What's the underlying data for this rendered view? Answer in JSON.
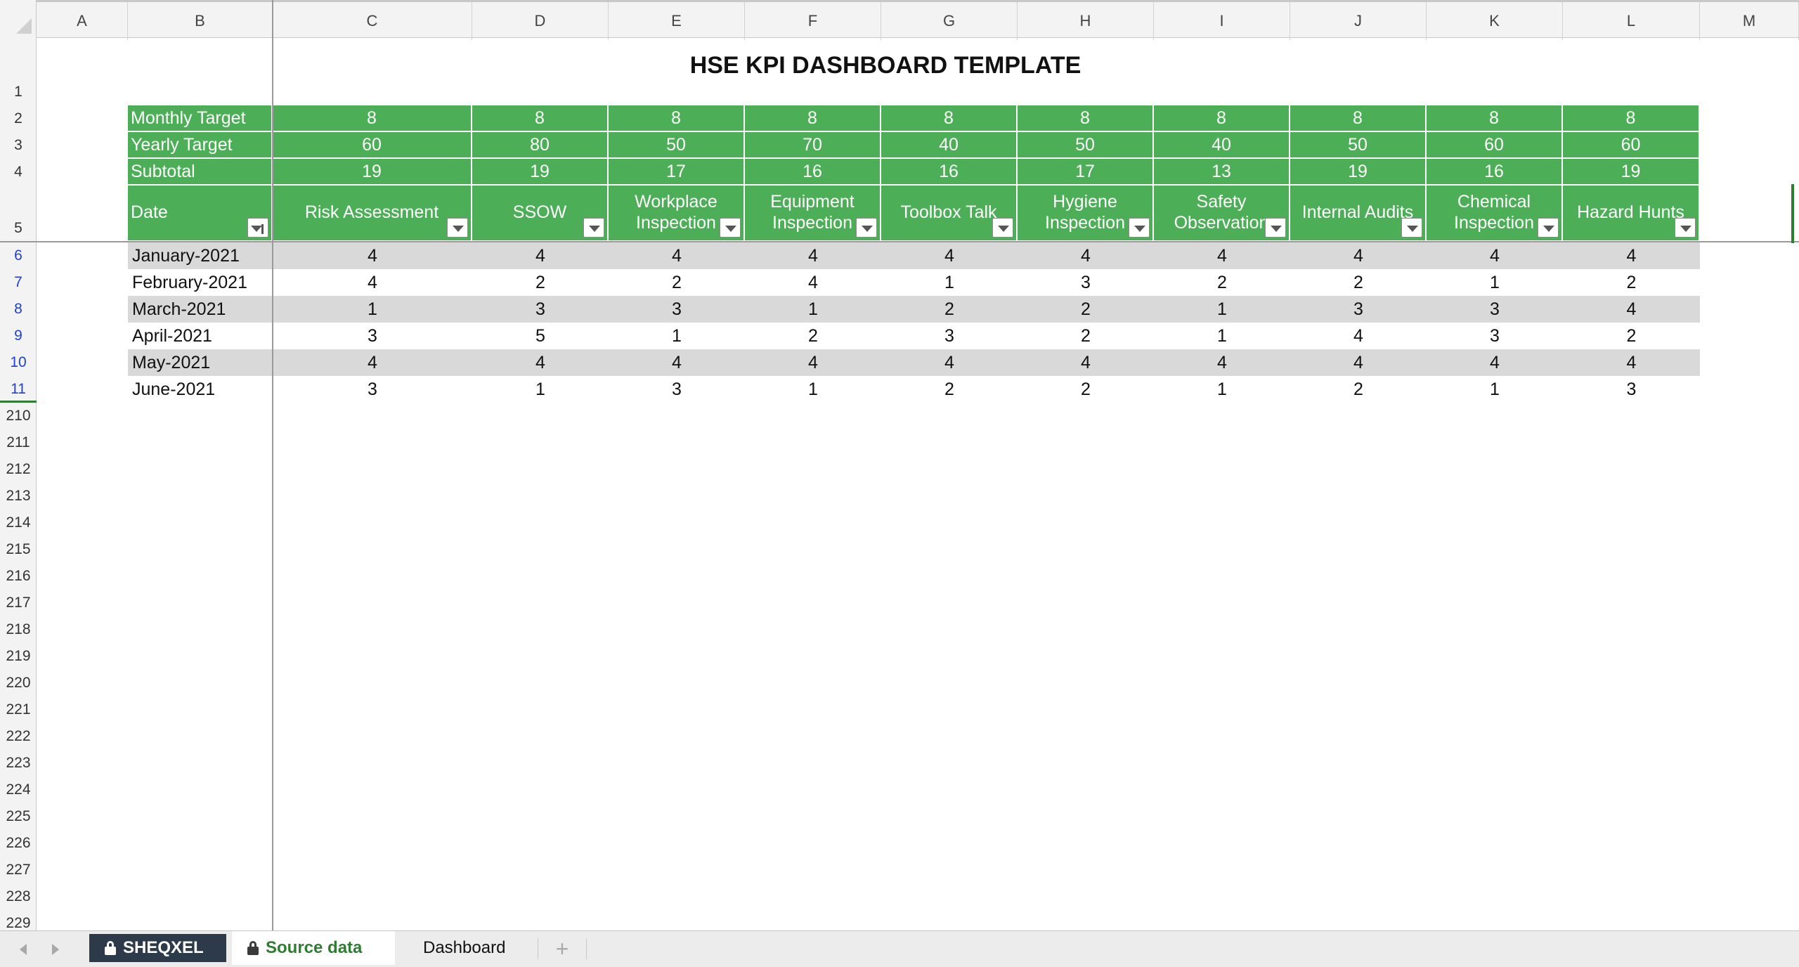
{
  "column_headers": [
    "A",
    "B",
    "C",
    "D",
    "E",
    "F",
    "G",
    "H",
    "I",
    "J",
    "K",
    "L",
    "M"
  ],
  "row_headers": [
    "1",
    "2",
    "3",
    "4",
    "5",
    "6",
    "7",
    "8",
    "9",
    "10",
    "11",
    "210",
    "211",
    "212",
    "213",
    "214",
    "215",
    "216",
    "217",
    "218",
    "219",
    "220",
    "221",
    "222",
    "223",
    "224",
    "225",
    "226",
    "227",
    "228",
    "229"
  ],
  "title": "HSE KPI DASHBOARD TEMPLATE",
  "summary_rows": [
    {
      "label": "Monthly  Target",
      "values": [
        "8",
        "8",
        "8",
        "8",
        "8",
        "8",
        "8",
        "8",
        "8",
        "8"
      ]
    },
    {
      "label": "Yearly Target",
      "values": [
        "60",
        "80",
        "50",
        "70",
        "40",
        "50",
        "40",
        "50",
        "60",
        "60"
      ]
    },
    {
      "label": "Subtotal",
      "values": [
        "19",
        "19",
        "17",
        "16",
        "16",
        "17",
        "13",
        "19",
        "16",
        "19"
      ]
    }
  ],
  "table_headers": {
    "date": "Date",
    "columns": [
      [
        "Risk Assessment"
      ],
      [
        "SSOW"
      ],
      [
        "Workplace",
        "Inspection"
      ],
      [
        "Equipment",
        "Inspection"
      ],
      [
        "Toolbox Talk"
      ],
      [
        "Hygiene",
        "Inspection"
      ],
      [
        "Safety",
        "Observation"
      ],
      [
        "Internal Audits"
      ],
      [
        "Chemical",
        "Inspection"
      ],
      [
        "Hazard Hunts"
      ]
    ]
  },
  "data_rows": [
    {
      "date": "January-2021",
      "values": [
        "4",
        "4",
        "4",
        "4",
        "4",
        "4",
        "4",
        "4",
        "4",
        "4"
      ]
    },
    {
      "date": "February-2021",
      "values": [
        "4",
        "2",
        "2",
        "4",
        "1",
        "3",
        "2",
        "2",
        "1",
        "2"
      ]
    },
    {
      "date": "March-2021",
      "values": [
        "1",
        "3",
        "3",
        "1",
        "2",
        "2",
        "1",
        "3",
        "3",
        "4"
      ]
    },
    {
      "date": "April-2021",
      "values": [
        "3",
        "5",
        "1",
        "2",
        "3",
        "2",
        "1",
        "4",
        "3",
        "2"
      ]
    },
    {
      "date": "May-2021",
      "values": [
        "4",
        "4",
        "4",
        "4",
        "4",
        "4",
        "4",
        "4",
        "4",
        "4"
      ]
    },
    {
      "date": "June-2021",
      "values": [
        "3",
        "1",
        "3",
        "1",
        "2",
        "2",
        "1",
        "2",
        "1",
        "3"
      ]
    }
  ],
  "sheet_tabs": [
    {
      "label": "SHEQXEL",
      "locked": true,
      "style": "dark"
    },
    {
      "label": "Source data",
      "locked": true,
      "style": "active"
    },
    {
      "label": "Dashboard",
      "locked": false,
      "style": "plain"
    }
  ],
  "add_sheet_symbol": "+",
  "colors": {
    "header_green": "#4caf57",
    "band_gray": "#d9d9d9",
    "tab_dark": "#2d3a4a",
    "active_tab_text": "#2e7d32",
    "row_number_blue": "#1f3fd6"
  },
  "icons": [
    "filter-dropdown-icon",
    "filter-funnel-icon",
    "lock-icon",
    "scroll-left-icon",
    "scroll-right-icon",
    "add-sheet-icon"
  ]
}
